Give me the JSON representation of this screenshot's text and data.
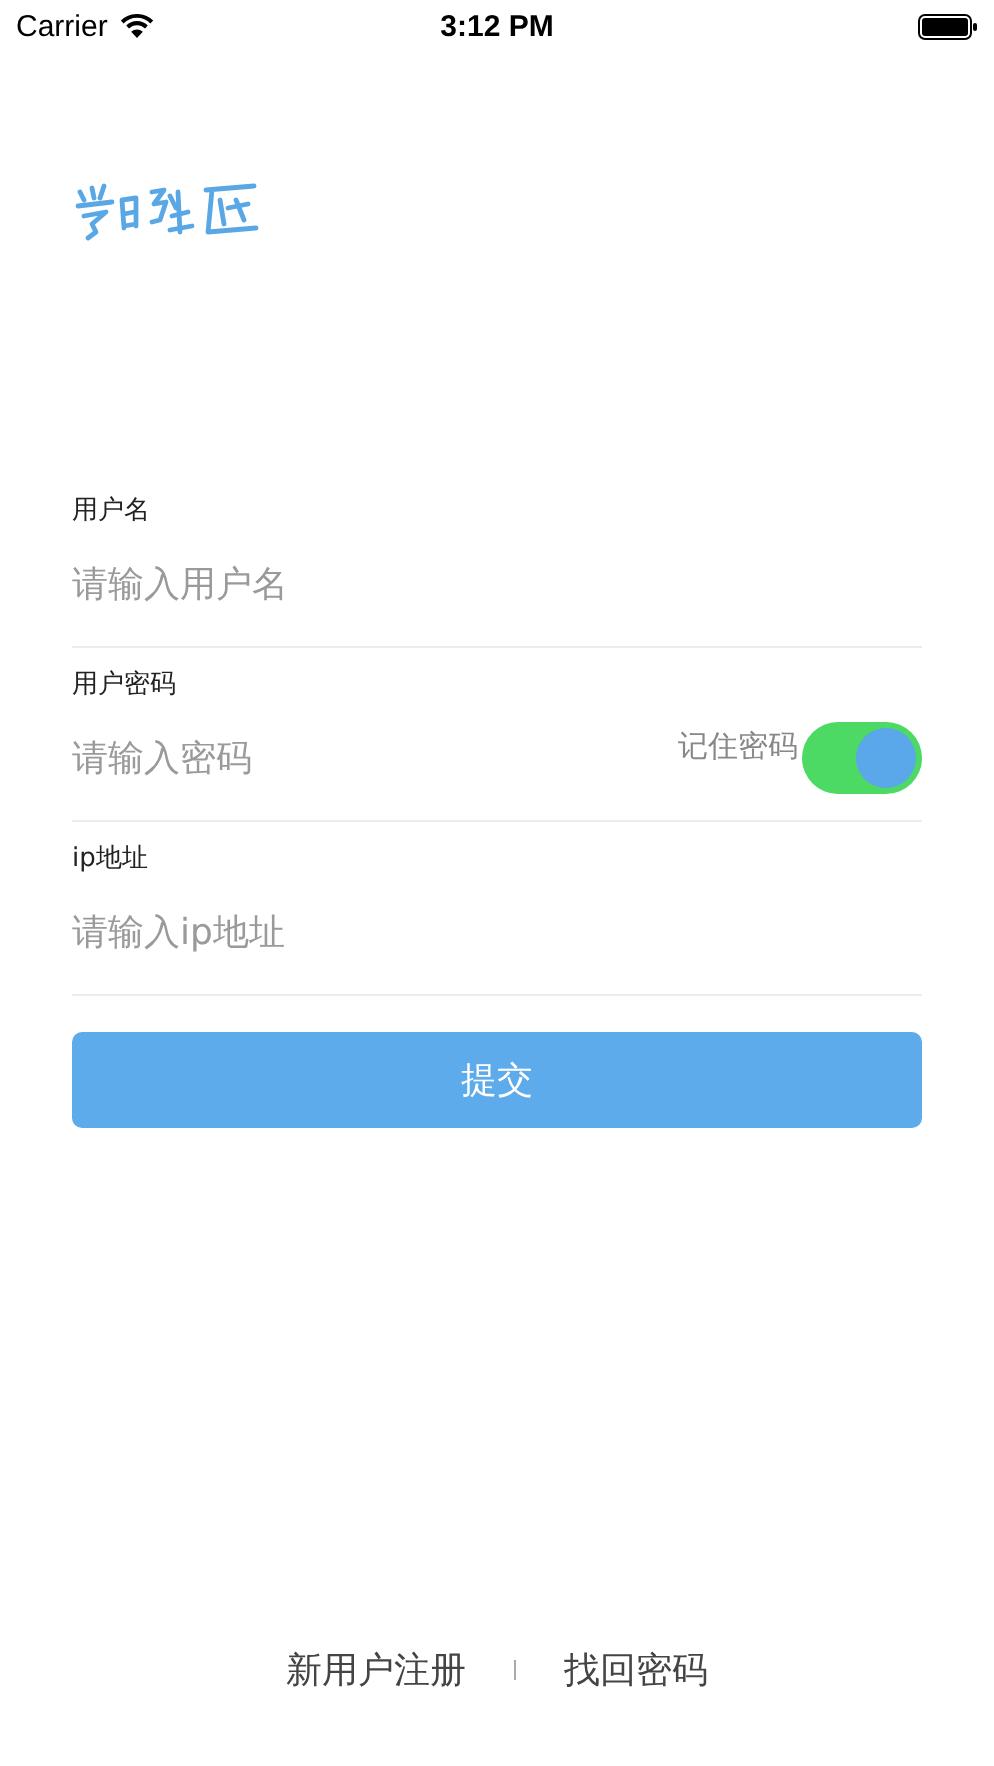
{
  "status_bar": {
    "carrier": "Carrier",
    "time": "3:12 PM"
  },
  "fields": [
    {
      "label": "用户名",
      "placeholder": "请输入用户名"
    },
    {
      "label": "用户密码",
      "placeholder": "请输入密码",
      "remember": {
        "label": "记住密码",
        "on": true
      }
    },
    {
      "label": "ip地址",
      "placeholder": "请输入ip地址"
    }
  ],
  "submit": "提交",
  "footer_links": [
    "新用户注册",
    "找回密码"
  ]
}
